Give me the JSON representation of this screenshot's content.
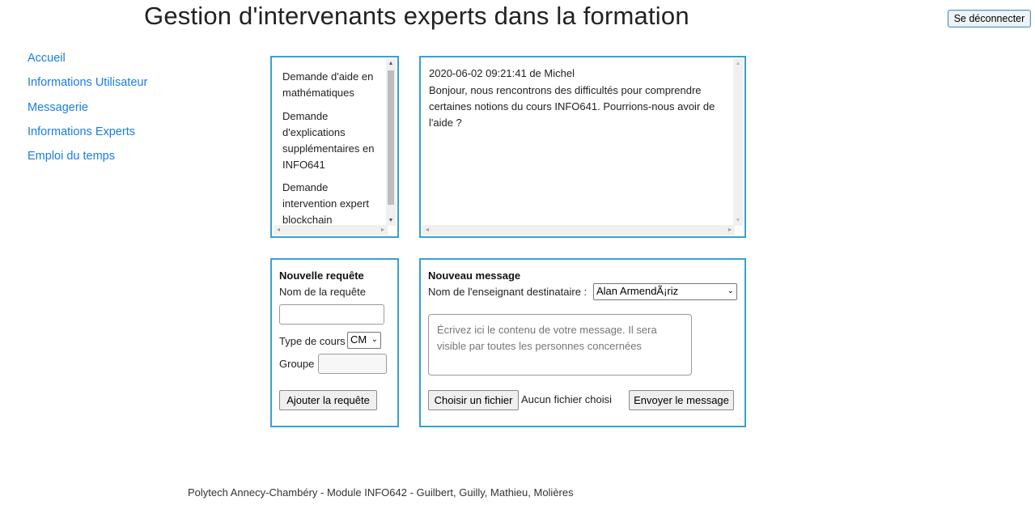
{
  "header": {
    "title": "Gestion d'intervenants experts dans la formation",
    "logout_label": "Se déconnecter"
  },
  "nav": {
    "items": [
      "Accueil",
      "Informations Utilisateur",
      "Messagerie",
      "Informations Experts",
      "Emploi du temps"
    ]
  },
  "requests": {
    "items": [
      "Demande d'aide en mathématiques",
      "Demande d'explications supplémentaires en INFO641",
      "Demande intervention expert blockchain"
    ]
  },
  "message": {
    "meta": "2020-06-02 09:21:41 de Michel",
    "body": "Bonjour, nous rencontrons des difficultés pour comprendre certaines notions du cours INFO641. Pourrions-nous avoir de l'aide ?"
  },
  "new_request": {
    "title": "Nouvelle requête",
    "name_label": "Nom de la requête",
    "name_value": "",
    "course_type_label": "Type de cours",
    "course_type_value": "CM",
    "group_label": "Groupe",
    "group_value": "",
    "submit_label": "Ajouter la requête"
  },
  "new_message": {
    "title": "Nouveau message",
    "recipient_label": "Nom de l'enseignant destinataire :",
    "recipient_value": "Alan ArmendÃ¡riz",
    "placeholder": "Écrivez ici le contenu de votre message. Il sera visible par toutes les personnes concernées",
    "file_button_label": "Choisir un fichier",
    "file_status": "Aucun fichier choisi",
    "send_label": "Envoyer le message"
  },
  "footer": {
    "text": "Polytech Annecy-Chambéry - Module INFO642 - Guilbert, Guilly, Mathieu, Molières"
  }
}
